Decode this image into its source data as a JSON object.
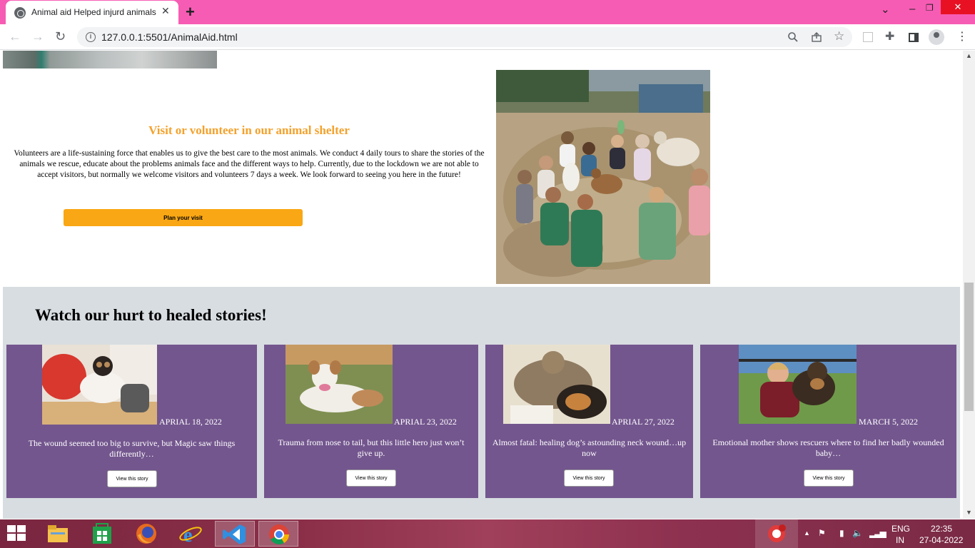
{
  "browser": {
    "tab_title": "Animal aid Helped injurd animals",
    "url": "127.0.0.1:5501/AnimalAid.html"
  },
  "visit": {
    "title": "Visit or volunteer in our animal shelter",
    "text": "Volunteers are a life-sustaining force that enables us to give the best care to the most animals. We conduct 4 daily tours to share the stories of the animals we rescue, educate about the problems animals face and the different ways to help. Currently, due to the lockdown we are not able to accept visitors, but normally we welcome visitors and volunteers 7 days a week. We look forward to seeing you here in the future!",
    "button_label": "Plan your visit"
  },
  "stories": {
    "title": "Watch our hurt to healed stories!",
    "cards": [
      {
        "date": "APRIAL 18, 2022",
        "text": "The wound seemed too big to survive, but Magic saw things differently…",
        "button_label": "View this story"
      },
      {
        "date": "APRIAL 23, 2022",
        "text": "Trauma from nose to tail, but this little hero just won’t give up.",
        "button_label": "View this story"
      },
      {
        "date": "APRIAL 27, 2022",
        "text": "Almost fatal: healing dog’s astounding neck wound…up now",
        "button_label": "View this story"
      },
      {
        "date": "MARCH 5, 2022",
        "text": "Emotional mother shows rescuers where to find her badly wounded baby…",
        "button_label": "View this story"
      }
    ]
  },
  "taskbar": {
    "language": "ENG",
    "region": "IN",
    "time": "22:35",
    "date": "27-04-2022"
  },
  "colors": {
    "tab_strip": "#f65cb3",
    "accent_orange": "#f9a714",
    "title_orange": "#f4a12b",
    "card_purple": "#73568e",
    "stories_bg": "#d8dde1"
  },
  "icons": [
    "globe-icon",
    "close-icon",
    "plus-icon",
    "chevron-down-icon",
    "minimize-icon",
    "restore-icon",
    "back-icon",
    "forward-icon",
    "reload-icon",
    "info-icon",
    "zoom-icon",
    "share-icon",
    "star-icon",
    "extension-icon",
    "puzzle-icon",
    "side-panel-icon",
    "profile-icon",
    "menu-icon",
    "windows-icon",
    "file-explorer-icon",
    "store-icon",
    "firefox-icon",
    "ie-icon",
    "vscode-icon",
    "chrome-icon"
  ]
}
